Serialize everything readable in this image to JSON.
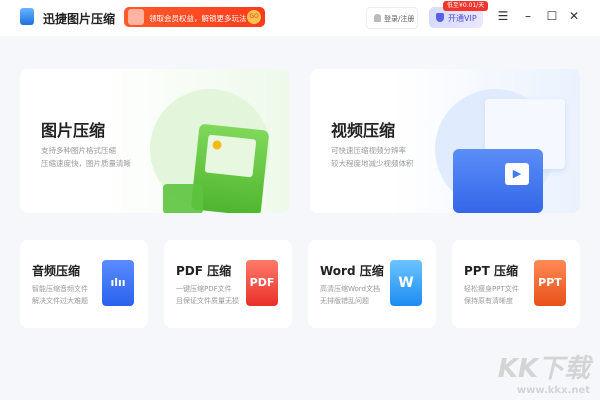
{
  "header": {
    "app_title": "迅捷图片压缩",
    "promo_text": "领取会员权益，解锁更多玩法",
    "promo_go": "GO",
    "login_label": "登录/注册",
    "vip_label": "开通VIP",
    "vip_badge": "低至¥0.01/天"
  },
  "window_controls": [
    "menu",
    "minimize",
    "maximize",
    "close"
  ],
  "big_cards": [
    {
      "title": "图片压缩",
      "lines": [
        "支持多种图片格式压缩",
        "压缩速度快，图片质量清晰"
      ],
      "color": "#5cc43e"
    },
    {
      "title": "视频压缩",
      "lines": [
        "可快速压缩视频分辨率",
        "较大程度地减少视频体积"
      ],
      "color": "#3d7bf5"
    }
  ],
  "small_cards": [
    {
      "title": "音频压缩",
      "lines": [
        "智能压缩音频文件",
        "解决文件过大难题"
      ],
      "icon_text": "ılıı",
      "color": "#3a75f5"
    },
    {
      "title": "PDF 压缩",
      "lines": [
        "一键压缩PDF文件",
        "且保证文件质量无损"
      ],
      "icon_text": "PDF",
      "color": "#f44a3e"
    },
    {
      "title": "Word 压缩",
      "lines": [
        "高清压缩Word文档",
        "无排版错乱问题"
      ],
      "icon_text": "W",
      "color": "#2f9cf5"
    },
    {
      "title": "PPT 压缩",
      "lines": [
        "轻松瘦身PPT文件",
        "保持原有清晰度"
      ],
      "icon_text": "PPT",
      "color": "#f5622a"
    }
  ],
  "watermark": {
    "brand": "KK下载",
    "url": "www.kkx.net"
  }
}
